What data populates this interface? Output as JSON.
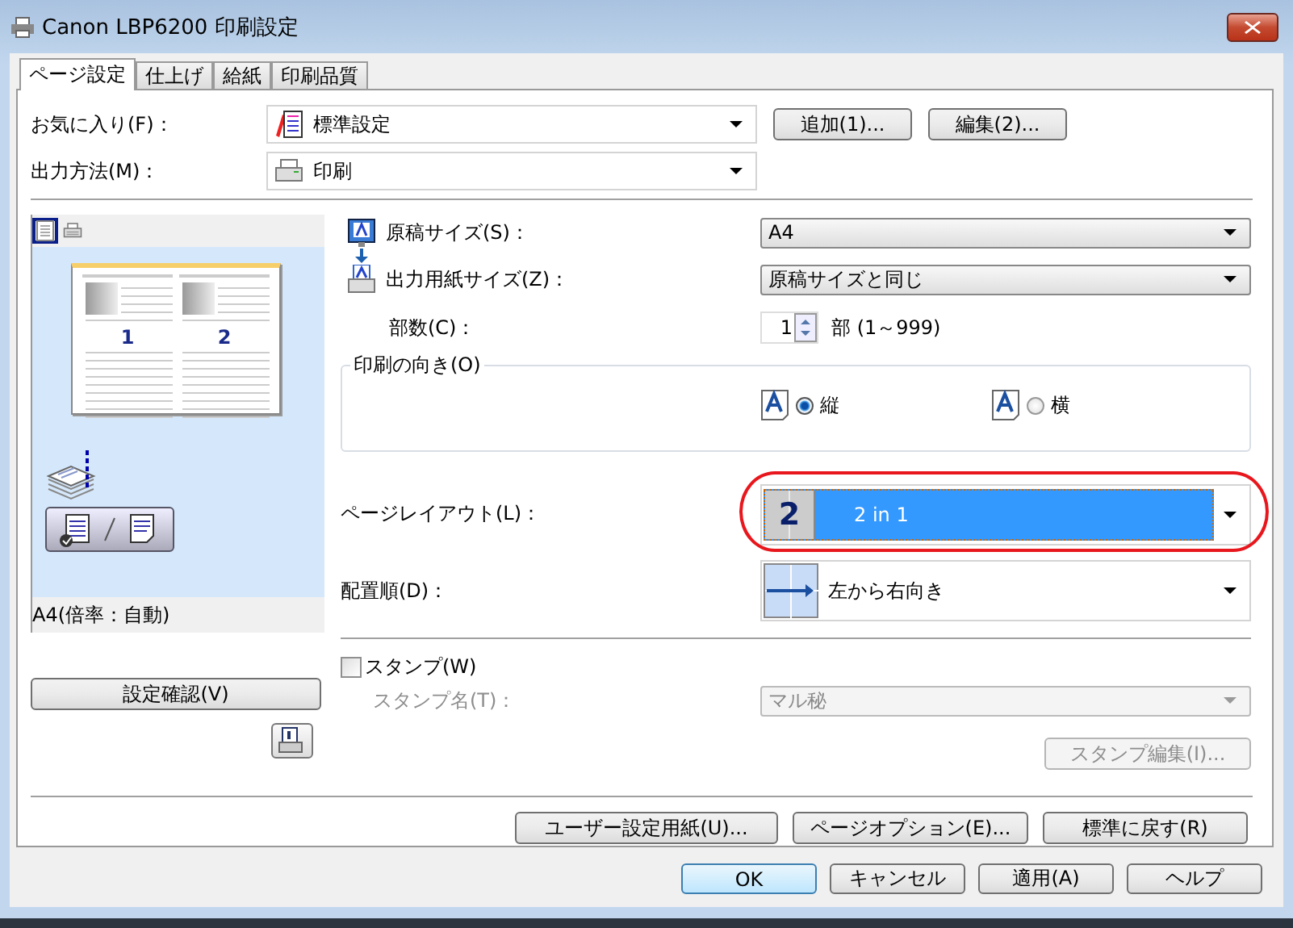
{
  "window": {
    "title": "Canon LBP6200 印刷設定"
  },
  "tabs": [
    {
      "label": "ページ設定",
      "selected": true
    },
    {
      "label": "仕上げ",
      "selected": false
    },
    {
      "label": "給紙",
      "selected": false
    },
    {
      "label": "印刷品質",
      "selected": false
    }
  ],
  "favorites": {
    "label": "お気に入り(F)：",
    "value": "標準設定"
  },
  "output_method": {
    "label": "出力方法(M)：",
    "value": "印刷"
  },
  "favorite_buttons": [
    "追加(1)...",
    "編集(2)..."
  ],
  "preview": {
    "view_modes": [
      {
        "kind": "page",
        "selected": true
      },
      {
        "kind": "printer",
        "selected": false
      }
    ],
    "pages": [
      "1",
      "2"
    ],
    "caption": "A4(倍率：自動)"
  },
  "confirm_button": "設定確認(V)",
  "original_size": {
    "label": "原稿サイズ(S)：",
    "value": "A4"
  },
  "output_size": {
    "label": "出力用紙サイズ(Z)：",
    "value": "原稿サイズと同じ"
  },
  "copies": {
    "label": "部数(C)：",
    "value": "1",
    "range": "部 (1～999)"
  },
  "orientation": {
    "label": "印刷の向き(O)",
    "options": [
      {
        "label": "縦",
        "selected": true
      },
      {
        "label": "横",
        "selected": false
      }
    ]
  },
  "page_layout": {
    "label": "ページレイアウト(L)：",
    "icon_text": "2",
    "value": "2 in 1",
    "circled": true
  },
  "order": {
    "label": "配置順(D)：",
    "value": "左から右向き"
  },
  "stamp": {
    "label": "スタンプ(W)",
    "checked": false,
    "name_label": "スタンプ名(T)：",
    "name_value": "マル秘",
    "edit_button": "スタンプ編集(I)..."
  },
  "page_buttons": [
    "ユーザー設定用紙(U)...",
    "ページオプション(E)...",
    "標準に戻す(R)"
  ],
  "dialog_buttons": [
    {
      "label": "OK",
      "default": true
    },
    {
      "label": "キャンセル",
      "default": false
    },
    {
      "label": "適用(A)",
      "default": false
    },
    {
      "label": "ヘルプ",
      "default": false
    }
  ]
}
